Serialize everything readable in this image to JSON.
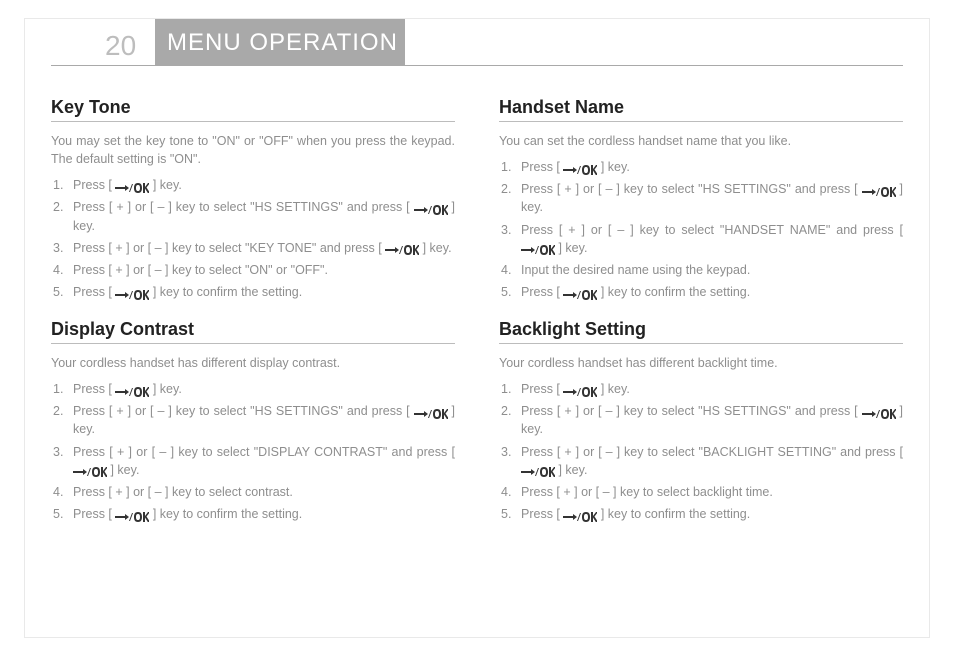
{
  "page_number": "20",
  "header_title": "MENU OPERATION",
  "icons": {
    "menu_ok": "menu-ok"
  },
  "left": {
    "section1": {
      "title": "Key Tone",
      "intro": "You may set the key tone to \"ON\" or \"OFF\" when you press the keypad. The default setting is \"ON\".",
      "steps": [
        {
          "pre": "Press [ ",
          "icon": true,
          "post": " ] key."
        },
        {
          "pre": "Press [ + ] or [ – ] key to select \"HS SETTINGS\" and press [ ",
          "icon": true,
          "post": " ] key."
        },
        {
          "pre": "Press [ + ] or [ – ] key to select \"KEY TONE\" and press [ ",
          "icon": true,
          "post": " ] key."
        },
        {
          "pre": "Press [ + ] or [ – ] key to select \"ON\" or \"OFF\".",
          "icon": false,
          "post": ""
        },
        {
          "pre": "Press [ ",
          "icon": true,
          "post": " ] key to confirm the setting."
        }
      ]
    },
    "section2": {
      "title": "Display Contrast",
      "intro": "Your cordless handset has different display contrast.",
      "steps": [
        {
          "pre": "Press [ ",
          "icon": true,
          "post": " ] key."
        },
        {
          "pre": "Press [ + ] or [ – ] key to select \"HS SETTINGS\" and press [ ",
          "icon": true,
          "post": " ] key."
        },
        {
          "pre": "Press [ + ] or [ – ] key to select \"DISPLAY CONTRAST\" and press [ ",
          "icon": true,
          "post": " ] key."
        },
        {
          "pre": "Press [ + ] or [ – ] key to select contrast.",
          "icon": false,
          "post": ""
        },
        {
          "pre": "Press [ ",
          "icon": true,
          "post": " ] key to confirm the setting."
        }
      ]
    }
  },
  "right": {
    "section1": {
      "title": "Handset Name",
      "intro": "You can set the cordless handset name that you like.",
      "steps": [
        {
          "pre": "Press [ ",
          "icon": true,
          "post": " ] key."
        },
        {
          "pre": "Press [ + ] or [ – ] key to select \"HS SETTINGS\" and press [ ",
          "icon": true,
          "post": " ] key."
        },
        {
          "pre": "Press [ + ] or [ – ] key to select \"HANDSET NAME\" and press [ ",
          "icon": true,
          "post": " ] key."
        },
        {
          "pre": "Input the desired name using the keypad.",
          "icon": false,
          "post": ""
        },
        {
          "pre": "Press [ ",
          "icon": true,
          "post": " ] key to confirm the setting."
        }
      ]
    },
    "section2": {
      "title": "Backlight Setting",
      "intro": "Your cordless handset has different backlight time.",
      "steps": [
        {
          "pre": "Press [ ",
          "icon": true,
          "post": " ] key."
        },
        {
          "pre": "Press [ + ] or [ – ] key to select \"HS SETTINGS\" and press [ ",
          "icon": true,
          "post": " ] key."
        },
        {
          "pre": "Press [ + ] or [ – ] key to select \"BACKLIGHT SETTING\" and press [ ",
          "icon": true,
          "post": " ] key."
        },
        {
          "pre": "Press [ + ] or [ – ] key to select backlight time.",
          "icon": false,
          "post": ""
        },
        {
          "pre": "Press [ ",
          "icon": true,
          "post": " ] key to confirm the setting."
        }
      ]
    }
  }
}
